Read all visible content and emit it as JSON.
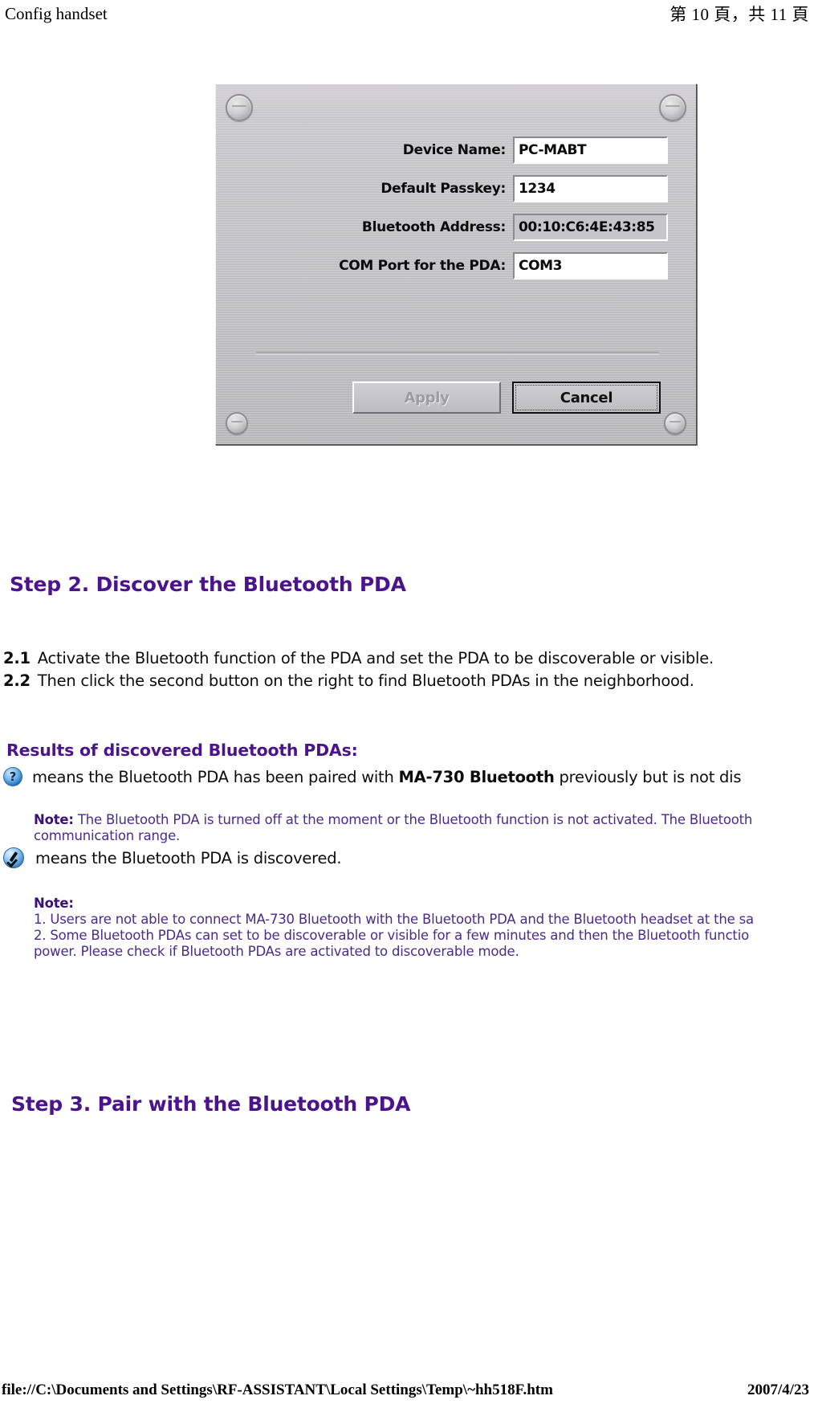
{
  "page_header": {
    "left_title": "Config handset",
    "right_pagination": "第 10 頁，共 11 頁"
  },
  "dialog": {
    "fields": [
      {
        "label": "Device Name:",
        "value": "PC-MABT",
        "readonly": false
      },
      {
        "label": "Default Passkey:",
        "value": "1234",
        "readonly": false
      },
      {
        "label": "Bluetooth Address:",
        "value": "00:10:C6:4E:43:85",
        "readonly": true
      },
      {
        "label": "COM Port for the PDA:",
        "value": "COM3",
        "readonly": false
      }
    ],
    "buttons": {
      "apply_label": "Apply",
      "cancel_label": "Cancel"
    }
  },
  "content": {
    "step2_heading": "Step 2. Discover the Bluetooth PDA",
    "step2_items": [
      {
        "num": "2.1",
        "text": "Activate the Bluetooth function of the PDA and set the PDA to be discoverable or visible."
      },
      {
        "num": "2.2",
        "text": "Then click the second button on the right to find Bluetooth PDAs in the neighborhood."
      }
    ],
    "results_heading": "Results of discovered Bluetooth PDAs:",
    "legend_question": {
      "text_before": "means the Bluetooth PDA has been paired with ",
      "bold": "MA-730 Bluetooth",
      "text_after": " previously but is not dis"
    },
    "note_1": {
      "label": "Note:",
      "line1": " The Bluetooth PDA is turned off at the moment or the Bluetooth function is not activated. The Bluetooth",
      "line2": "communication range."
    },
    "legend_check": {
      "text": "means the Bluetooth PDA is discovered."
    },
    "note_2": {
      "label": "Note:",
      "line1": "1. Users are not able to connect MA-730 Bluetooth with the Bluetooth PDA and the Bluetooth headset at the sa",
      "line2": "2. Some Bluetooth PDAs can set to be discoverable or visible for a few minutes and then the Bluetooth functio",
      "line3": "power. Please check if Bluetooth PDAs are activated to discoverable mode."
    },
    "step3_heading": "Step 3. Pair with the Bluetooth PDA"
  },
  "page_footer": {
    "file_path": "file://C:\\Documents and Settings\\RF-ASSISTANT\\Local Settings\\Temp\\~hh518F.htm",
    "date": "2007/4/23"
  },
  "colors": {
    "heading_purple": "#4b148c",
    "note_purple": "#4b2a8c",
    "dialog_face": "#c4c4c8"
  }
}
